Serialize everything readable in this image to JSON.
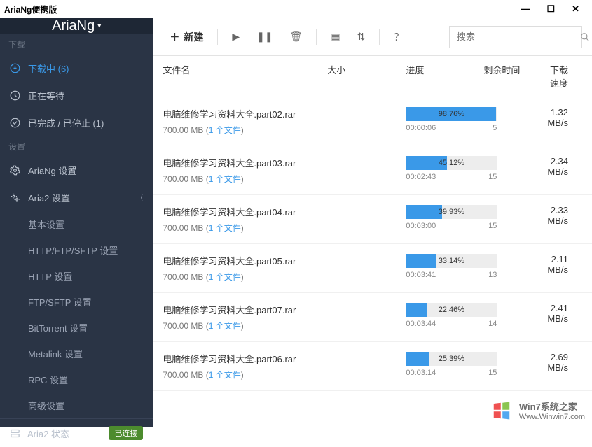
{
  "window": {
    "title": "AriaNg便携版"
  },
  "brand": "AriaNg",
  "sidebar": {
    "section_download": "下载",
    "items": [
      {
        "label": "下载中 (6)"
      },
      {
        "label": "正在等待"
      },
      {
        "label": "已完成 / 已停止 (1)"
      }
    ],
    "section_settings": "设置",
    "ariang_settings": "AriaNg 设置",
    "aria2_settings": "Aria2 设置",
    "subs": [
      "基本设置",
      "HTTP/FTP/SFTP 设置",
      "HTTP 设置",
      "FTP/SFTP 设置",
      "BitTorrent 设置",
      "Metalink 设置",
      "RPC 设置",
      "高级设置"
    ],
    "status_label": "Aria2 状态",
    "status_badge": "已连接"
  },
  "toolbar": {
    "new_label": "新建",
    "search_placeholder": "搜索"
  },
  "columns": {
    "name": "文件名",
    "size": "大小",
    "progress": "进度",
    "time": "剩余时间",
    "speed": "下载速度"
  },
  "file_meta": {
    "size": "700.00 MB",
    "count_prefix": "(",
    "count_label": "1 个文件",
    "count_suffix": ")"
  },
  "rows": [
    {
      "name": "电脑维修学习资料大全.part02.rar",
      "pct": 98.76,
      "pct_s": "98.76%",
      "elapsed": "00:00:06",
      "conn": "5",
      "speed": "1.32 MB/s"
    },
    {
      "name": "电脑维修学习资料大全.part03.rar",
      "pct": 45.12,
      "pct_s": "45.12%",
      "elapsed": "00:02:43",
      "conn": "15",
      "speed": "2.34 MB/s"
    },
    {
      "name": "电脑维修学习资料大全.part04.rar",
      "pct": 39.93,
      "pct_s": "39.93%",
      "elapsed": "00:03:00",
      "conn": "15",
      "speed": "2.33 MB/s"
    },
    {
      "name": "电脑维修学习资料大全.part05.rar",
      "pct": 33.14,
      "pct_s": "33.14%",
      "elapsed": "00:03:41",
      "conn": "13",
      "speed": "2.11 MB/s"
    },
    {
      "name": "电脑维修学习资料大全.part07.rar",
      "pct": 22.46,
      "pct_s": "22.46%",
      "elapsed": "00:03:44",
      "conn": "14",
      "speed": "2.41 MB/s"
    },
    {
      "name": "电脑维修学习资料大全.part06.rar",
      "pct": 25.39,
      "pct_s": "25.39%",
      "elapsed": "00:03:14",
      "conn": "15",
      "speed": "2.69 MB/s"
    }
  ],
  "watermark": {
    "line1": "Win7系统之家",
    "line2": "Www.Winwin7.com"
  }
}
